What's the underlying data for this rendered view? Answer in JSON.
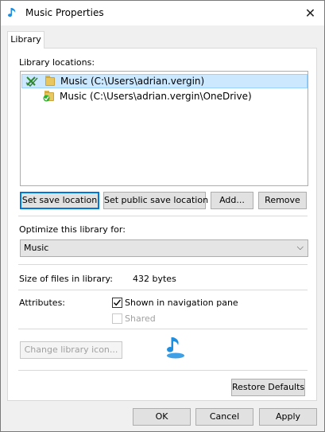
{
  "window": {
    "title": "Music Properties",
    "close_glyph": "✕"
  },
  "tabs": [
    {
      "label": "Library",
      "active": true
    }
  ],
  "library": {
    "locations_label": "Library locations:",
    "locations": [
      {
        "path": "Music (C:\\Users\\adrian.vergin)",
        "selected": true,
        "default_save": true,
        "icon": "folder-default-save-icon"
      },
      {
        "path": "Music (C:\\Users\\adrian.vergin\\OneDrive)",
        "selected": false,
        "default_save": false,
        "icon": "folder-synced-icon"
      }
    ],
    "buttons": {
      "set_save": "Set save location",
      "set_public_save": "Set public save location",
      "add": "Add...",
      "remove": "Remove"
    },
    "optimize_label": "Optimize this library for:",
    "optimize_value": "Music",
    "size_label": "Size of files in library:",
    "size_value": "432 bytes",
    "attributes_label": "Attributes:",
    "attributes": {
      "shown_in_nav": {
        "label": "Shown in navigation pane",
        "checked": true,
        "enabled": true
      },
      "shared": {
        "label": "Shared",
        "checked": false,
        "enabled": false
      }
    },
    "change_icon_label": "Change library icon...",
    "restore_defaults": "Restore Defaults"
  },
  "dialog_buttons": {
    "ok": "OK",
    "cancel": "Cancel",
    "apply": "Apply"
  },
  "colors": {
    "accent": "#0078d7",
    "selection": "#cce8ff",
    "music_icon": "#1e8fe0"
  }
}
